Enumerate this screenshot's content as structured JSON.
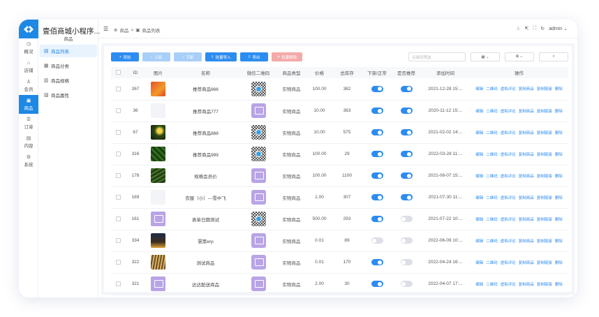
{
  "app": {
    "title": "壹佰商城小程序..."
  },
  "rail": [
    {
      "label": "概况",
      "icon": "dashboard-icon",
      "glyph": "◷"
    },
    {
      "label": "店铺",
      "icon": "shop-icon",
      "glyph": "⌂"
    },
    {
      "label": "会员",
      "icon": "user-icon",
      "glyph": "♙"
    },
    {
      "label": "商品",
      "icon": "goods-icon",
      "glyph": "▣",
      "active": true
    },
    {
      "label": "订单",
      "icon": "order-icon",
      "glyph": "☰"
    },
    {
      "label": "内容",
      "icon": "content-icon",
      "glyph": "▤"
    },
    {
      "label": "系统",
      "icon": "settings-icon",
      "glyph": "⚙"
    }
  ],
  "submenu": {
    "heading": "商品",
    "items": [
      {
        "label": "商品列表",
        "icon": "list-icon",
        "glyph": "▤",
        "active": true
      },
      {
        "label": "商品分类",
        "icon": "category-icon",
        "glyph": "▦"
      },
      {
        "label": "商品规格",
        "icon": "spec-icon",
        "glyph": "▥"
      },
      {
        "label": "商品属性",
        "icon": "attribute-icon",
        "glyph": "▧"
      }
    ]
  },
  "breadcrumb": {
    "home": "商品",
    "separator": ">",
    "current": "商品列表"
  },
  "topbar": {
    "user": "admin"
  },
  "toolbar": {
    "add": "添加",
    "on_shelf": "上架",
    "off_shelf": "下架",
    "bulk_import": "批量导入",
    "export": "导出",
    "bulk_delete": "批量删除"
  },
  "filters": {
    "keyword_placeholder": "关键词筛选",
    "select1": "▦ ⌄",
    "select2": "⧉ ⌄",
    "search": "⌕"
  },
  "table": {
    "headers": [
      "",
      "ID",
      "图片",
      "名称",
      "微信二维码",
      "商品类型",
      "价格",
      "总库存",
      "下架/正常",
      "是否推荐",
      "添加时间",
      "操作"
    ],
    "actions": [
      "编辑",
      "二维码",
      "虚拟评论",
      "复制商品",
      "复制链接",
      "删除"
    ],
    "rows": [
      {
        "id": "267",
        "img": "img1",
        "name": "推荐商品666",
        "qr": "code",
        "type": "实物商品",
        "price": "100.00",
        "stock": "382",
        "status": "on",
        "recommend": "on",
        "time": "2021-12-28 15:..."
      },
      {
        "id": "36",
        "img": "blank",
        "name": "推荐商品777",
        "qr": "ph",
        "type": "实物商品",
        "price": "10.00",
        "stock": "383",
        "status": "on",
        "recommend": "on",
        "time": "2020-11-12 15:..."
      },
      {
        "id": "67",
        "img": "img2",
        "name": "推荐商品888",
        "qr": "code",
        "type": "实物商品",
        "price": "10.00",
        "stock": "575",
        "status": "on",
        "recommend": "on",
        "time": "2021-02-02 14:..."
      },
      {
        "id": "316",
        "img": "img3",
        "name": "推荐商品999",
        "qr": "code",
        "type": "实物商品",
        "price": "100.00",
        "stock": "29",
        "status": "on",
        "recommend": "on",
        "time": "2022-03-28 11:..."
      },
      {
        "id": "178",
        "img": "img4",
        "name": "规格会员价",
        "qr": "ph",
        "type": "实物商品",
        "price": "100.00",
        "stock": "1100",
        "status": "on",
        "recommend": "on",
        "time": "2021-08-07 15:..."
      },
      {
        "id": "169",
        "img": "blank",
        "name": "衣服（小）---雪中飞",
        "qr": "ph",
        "type": "实物商品",
        "price": "1.00",
        "stock": "307",
        "status": "on",
        "recommend": "on",
        "time": "2021-07-30 11:..."
      },
      {
        "id": "161",
        "img": "ph",
        "name": "表单日期测试",
        "qr": "code",
        "type": "实物商品",
        "price": "500.00",
        "stock": "293",
        "status": "on",
        "recommend": "off",
        "time": "2021-07-22 10:..."
      },
      {
        "id": "334",
        "img": "img5",
        "name": "慧策erp",
        "qr": "ph",
        "type": "实物商品",
        "price": "0.01",
        "stock": "89",
        "status": "off",
        "recommend": "off",
        "time": "2022-06-09 10:..."
      },
      {
        "id": "322",
        "img": "img6",
        "name": "测试商品",
        "qr": "ph",
        "type": "实物商品",
        "price": "0.01",
        "stock": "170",
        "status": "on",
        "recommend": "off",
        "time": "2022-04-24 16:..."
      },
      {
        "id": "321",
        "img": "ph",
        "name": "达达配送商品",
        "qr": "ph",
        "type": "实物商品",
        "price": "2.00",
        "stock": "30",
        "status": "on",
        "recommend": "off",
        "time": "2022-04-07 17:..."
      }
    ]
  }
}
